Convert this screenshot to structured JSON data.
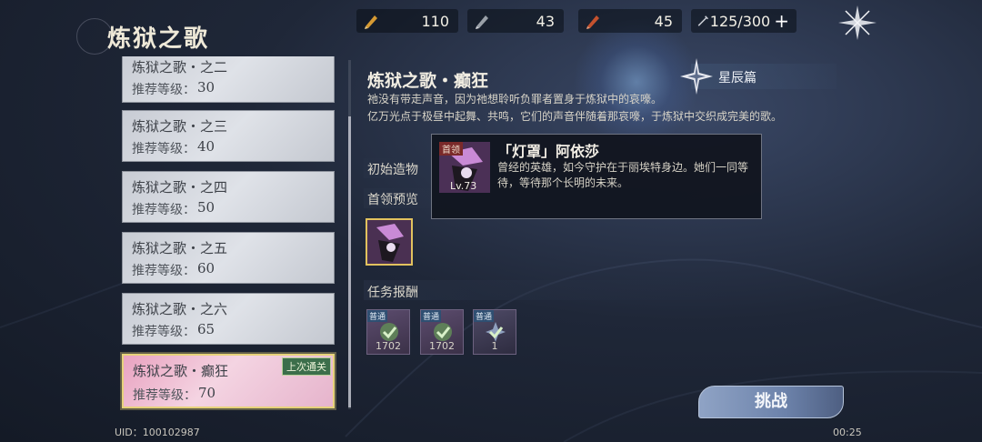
{
  "header": {
    "title": "炼狱之歌",
    "resources": [
      {
        "icon": "gold-pen-icon",
        "value": "110"
      },
      {
        "icon": "silver-pen-icon",
        "value": "43"
      },
      {
        "icon": "red-pen-icon",
        "value": "45"
      },
      {
        "icon": "energy-icon",
        "value": "125/300"
      }
    ],
    "plus_label": "+"
  },
  "stages": [
    {
      "name": "炼狱之歌・之二",
      "level_label": "推荐等级：",
      "level": "30"
    },
    {
      "name": "炼狱之歌・之三",
      "level_label": "推荐等级：",
      "level": "40"
    },
    {
      "name": "炼狱之歌・之四",
      "level_label": "推荐等级：",
      "level": "50"
    },
    {
      "name": "炼狱之歌・之五",
      "level_label": "推荐等级：",
      "level": "60"
    },
    {
      "name": "炼狱之歌・之六",
      "level_label": "推荐等级：",
      "level": "65"
    },
    {
      "name": "炼狱之歌・癫狂",
      "level_label": "推荐等级：",
      "level": "70",
      "badge": "上次通关"
    }
  ],
  "detail": {
    "title": "炼狱之歌・癫狂",
    "description_1": "祂没有带走声音，因为祂想聆听负罪者置身于炼狱中的哀嚎。",
    "description_2": "亿万光点于极昼中起舞、共鸣，它们的声音伴随着那哀嚎，于炼狱中交织成完美的歌。",
    "chapter": "星辰篇",
    "initial_artifact_label": "初始造物",
    "boss_preview_label": "首领预览",
    "rewards_label": "任务报酬",
    "rewards": [
      {
        "badge": "普通",
        "count": "1702"
      },
      {
        "badge": "普通",
        "count": "1702"
      },
      {
        "badge": "普通",
        "count": "1"
      }
    ],
    "challenge_label": "挑战"
  },
  "tooltip": {
    "rank": "首领",
    "level": "Lv.73",
    "name": "「灯罩」阿依莎",
    "text": "曾经的英雄，如今守护在于丽埃特身边。她们一同等待，等待那个长明的未来。"
  },
  "footer": {
    "uid": "UID：100102987",
    "timer": "00:25"
  }
}
